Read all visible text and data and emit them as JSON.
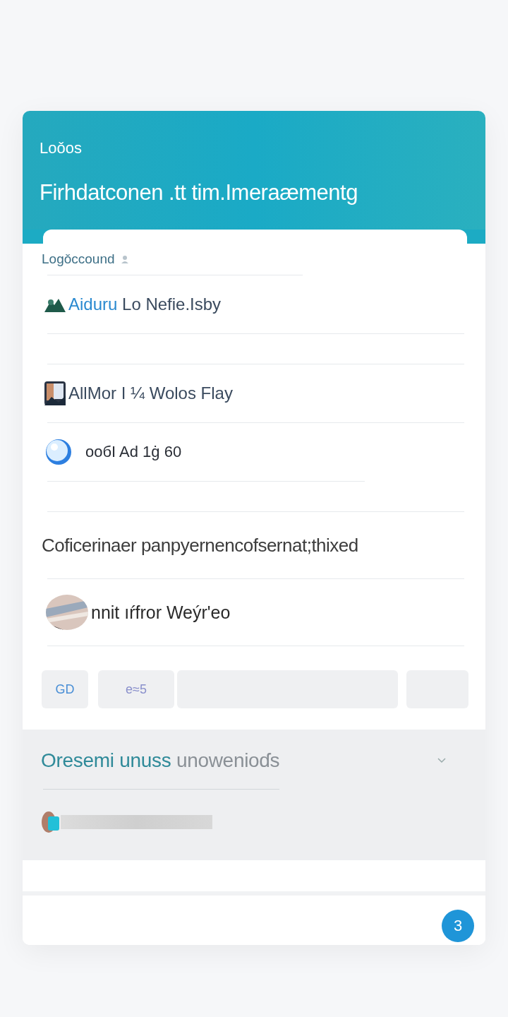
{
  "header": {
    "label": "Loǒos",
    "title": "Firhdatconen .tt tim.Imeraæmentg"
  },
  "account": {
    "label": "Logǒccound"
  },
  "items": [
    {
      "kind": "icon",
      "highlight": "Aiduru",
      "text": "Lo Nefie.Isby"
    },
    {
      "kind": "avatar",
      "text": "AllMor I ¼ Wolos Flay"
    },
    {
      "kind": "bubble",
      "text": "ообI Ad 1ġ 60"
    }
  ],
  "section": {
    "text": "Coficerinaer panpyernencofsernat;thixed"
  },
  "contact": {
    "text": "nnit ıŕfror Weýr'eo"
  },
  "actions": [
    {
      "kind": "button",
      "label": "GD",
      "color": "#4a8fd6"
    },
    {
      "kind": "button",
      "label": "e≈5",
      "color": "#8a90cc"
    },
    {
      "kind": "field"
    },
    {
      "kind": "button"
    }
  ],
  "panel": {
    "title": "Oresemi unuss",
    "subtitle": "unowenioɗs",
    "expanded": false
  },
  "badge": {
    "count": "3"
  }
}
